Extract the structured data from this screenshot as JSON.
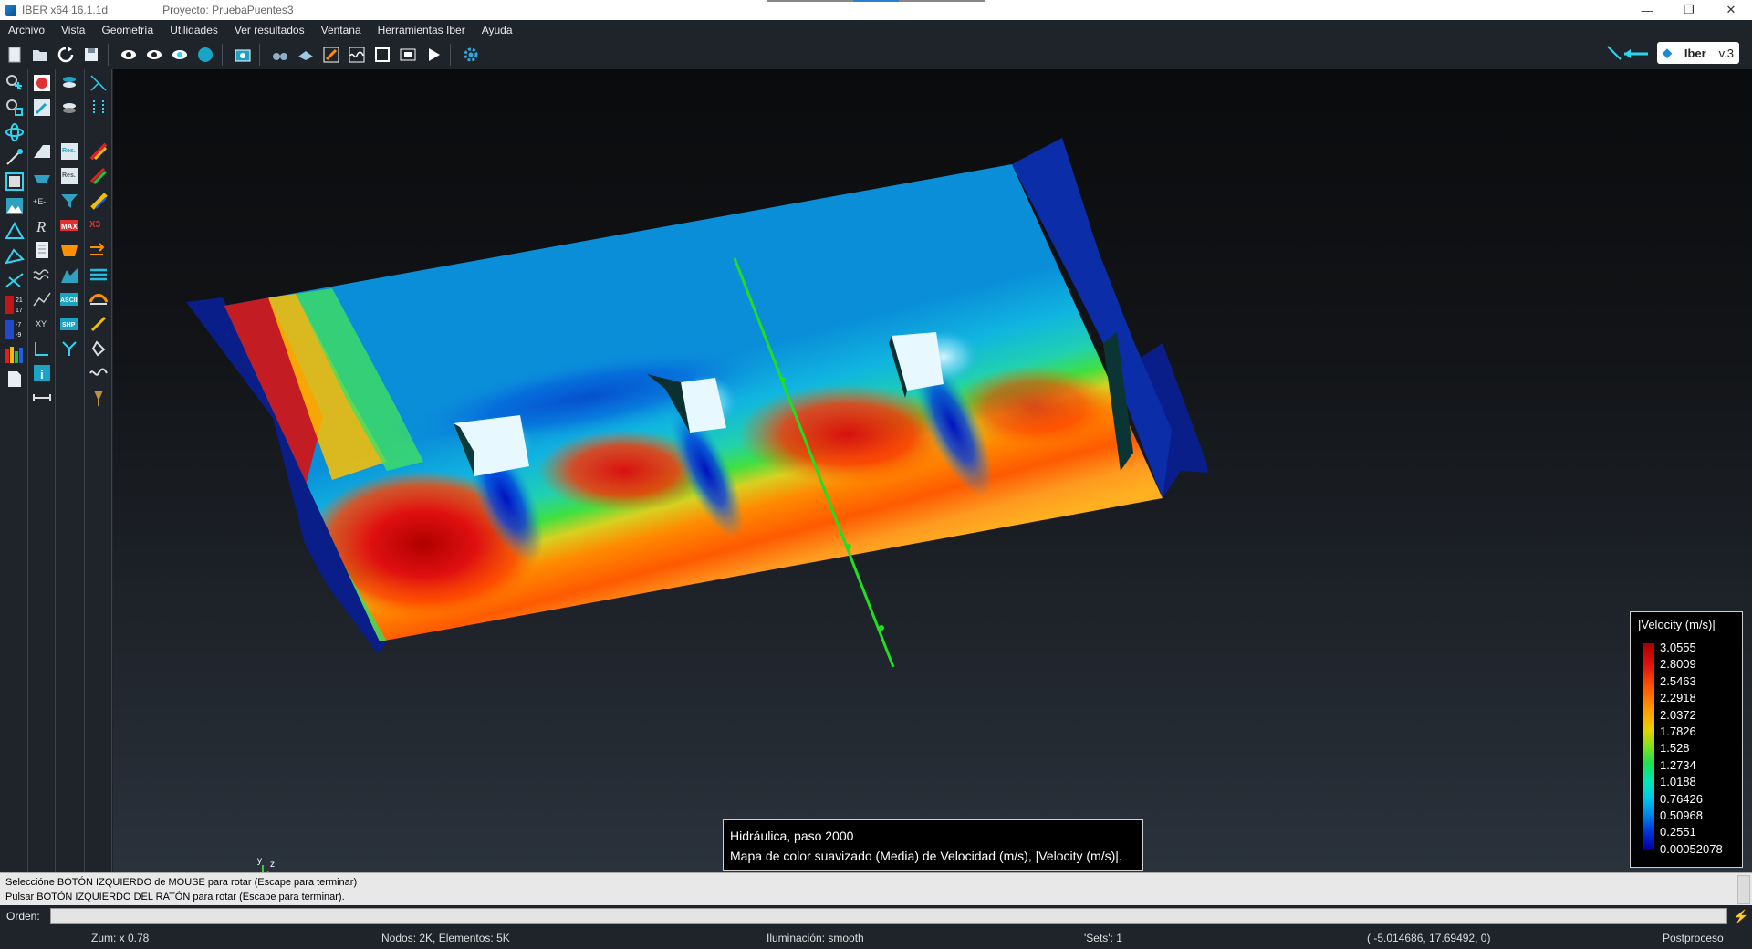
{
  "window": {
    "app_title": "IBER x64 16.1.1d",
    "project_title": "Proyecto: PruebaPuentes3",
    "min_glyph": "—",
    "restore_glyph": "❐",
    "close_glyph": "✕"
  },
  "menu": [
    "Archivo",
    "Vista",
    "Geometría",
    "Utilidades",
    "Ver resultados",
    "Ventana",
    "Herramientas Iber",
    "Ayuda"
  ],
  "brand": {
    "name": "Iber",
    "version": "v.3"
  },
  "legend": {
    "title": "|Velocity (m/s)|",
    "values": [
      "3.0555",
      "2.8009",
      "2.5463",
      "2.2918",
      "2.0372",
      "1.7826",
      "1.528",
      "1.2734",
      "1.0188",
      "0.76426",
      "0.50968",
      "0.2551",
      "0.00052078"
    ]
  },
  "info": {
    "line1": "Hidráulica, paso 2000",
    "line2": "Mapa de color suavizado (Media) de Velocidad (m/s), |Velocity (m/s)|."
  },
  "axes": {
    "y": "y",
    "z": "z",
    "x": "x"
  },
  "sidebar_labels": {
    "max_top": "21",
    "max_bottom": "17",
    "min_top": "-7",
    "min_bottom": "-9",
    "res": "Res.",
    "max": "MAX",
    "ascii": "ASCII",
    "shp": "SHP",
    "xy": "XY",
    "e": "+E-",
    "r": "R",
    "x3": "X3"
  },
  "messages": {
    "line1": "Seleccióne BOTÓN IZQUIERDO de MOUSE para rotar (Escape para terminar)",
    "line2": "Pulsar BOTÓN IZQUIERDO DEL RATÓN para rotar (Escape para terminar)."
  },
  "command": {
    "label": "Orden:",
    "value": ""
  },
  "status": {
    "zoom": "Zum: x 0.78",
    "nodes": "Nodos: 2K, Elementos: 5K",
    "lighting": "Iluminación: smooth",
    "sets": "'Sets': 1",
    "coords": "( -5.014686,  17.69492,  0)",
    "mode": "Postproceso"
  },
  "colors": {
    "accent": "#2fd5f0",
    "chrome": "#1f242a",
    "section_line": "#22dd22"
  }
}
